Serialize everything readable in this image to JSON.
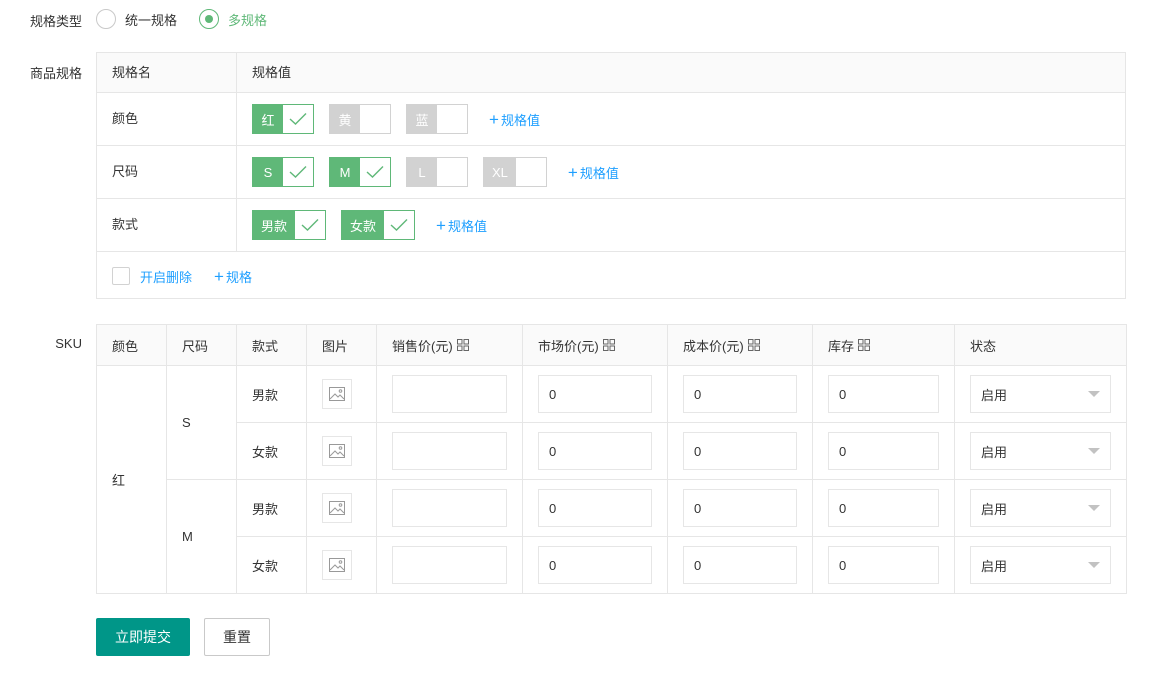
{
  "spec_type": {
    "label": "规格类型",
    "options": [
      {
        "label": "统一规格",
        "checked": false
      },
      {
        "label": "多规格",
        "checked": true
      }
    ]
  },
  "spec": {
    "label": "商品规格",
    "col_name": "规格名",
    "col_value": "规格值",
    "rows": [
      {
        "name": "颜色",
        "values": [
          {
            "v": "红",
            "on": true
          },
          {
            "v": "黄",
            "on": false
          },
          {
            "v": "蓝",
            "on": false
          }
        ]
      },
      {
        "name": "尺码",
        "values": [
          {
            "v": "S",
            "on": true
          },
          {
            "v": "M",
            "on": true
          },
          {
            "v": "L",
            "on": false
          },
          {
            "v": "XL",
            "on": false
          }
        ]
      },
      {
        "name": "款式",
        "values": [
          {
            "v": "男款",
            "on": true
          },
          {
            "v": "女款",
            "on": true
          }
        ]
      }
    ],
    "add_value": "规格值",
    "enable_delete": "开启删除",
    "add_spec": "规格"
  },
  "sku": {
    "label": "SKU",
    "headers": [
      "颜色",
      "尺码",
      "款式",
      "图片",
      "销售价(元)",
      "市场价(元)",
      "成本价(元)",
      "库存",
      "状态"
    ],
    "color": "红",
    "sizes": [
      "S",
      "M"
    ],
    "rows": [
      {
        "style": "男款",
        "sale": "",
        "market": "0",
        "cost": "0",
        "stock": "0",
        "status": "启用"
      },
      {
        "style": "女款",
        "sale": "",
        "market": "0",
        "cost": "0",
        "stock": "0",
        "status": "启用"
      },
      {
        "style": "男款",
        "sale": "",
        "market": "0",
        "cost": "0",
        "stock": "0",
        "status": "启用"
      },
      {
        "style": "女款",
        "sale": "",
        "market": "0",
        "cost": "0",
        "stock": "0",
        "status": "启用"
      }
    ]
  },
  "buttons": {
    "submit": "立即提交",
    "reset": "重置"
  },
  "colors": {
    "green": "#5fb878",
    "teal": "#009688",
    "link": "#1e9fff",
    "border": "#e6e6e6"
  }
}
